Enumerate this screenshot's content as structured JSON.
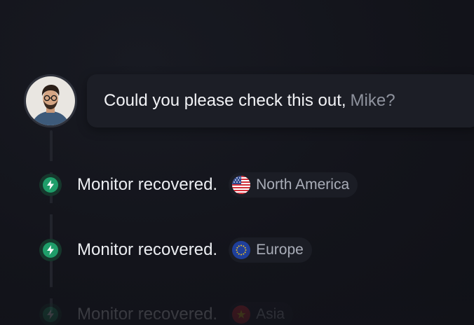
{
  "comment": {
    "text": "Could you please check this out,",
    "mention": "Mike?"
  },
  "events": [
    {
      "label": "Monitor recovered.",
      "region": "North America",
      "flag_icon": "us-flag-icon",
      "status_icon": "lightning-bolt-icon",
      "status_color": "#1f9e6a"
    },
    {
      "label": "Monitor recovered.",
      "region": "Europe",
      "flag_icon": "eu-flag-icon",
      "status_icon": "lightning-bolt-icon",
      "status_color": "#1f9e6a"
    },
    {
      "label": "Monitor recovered.",
      "region": "Asia",
      "flag_icon": "vietnam-flag-icon",
      "status_icon": "lightning-bolt-icon",
      "status_color": "#1f9e6a"
    }
  ],
  "colors": {
    "background": "#12131a",
    "bubble": "#1c1e26",
    "accent_green": "#1f9e6a",
    "mention": "#8f939e"
  }
}
